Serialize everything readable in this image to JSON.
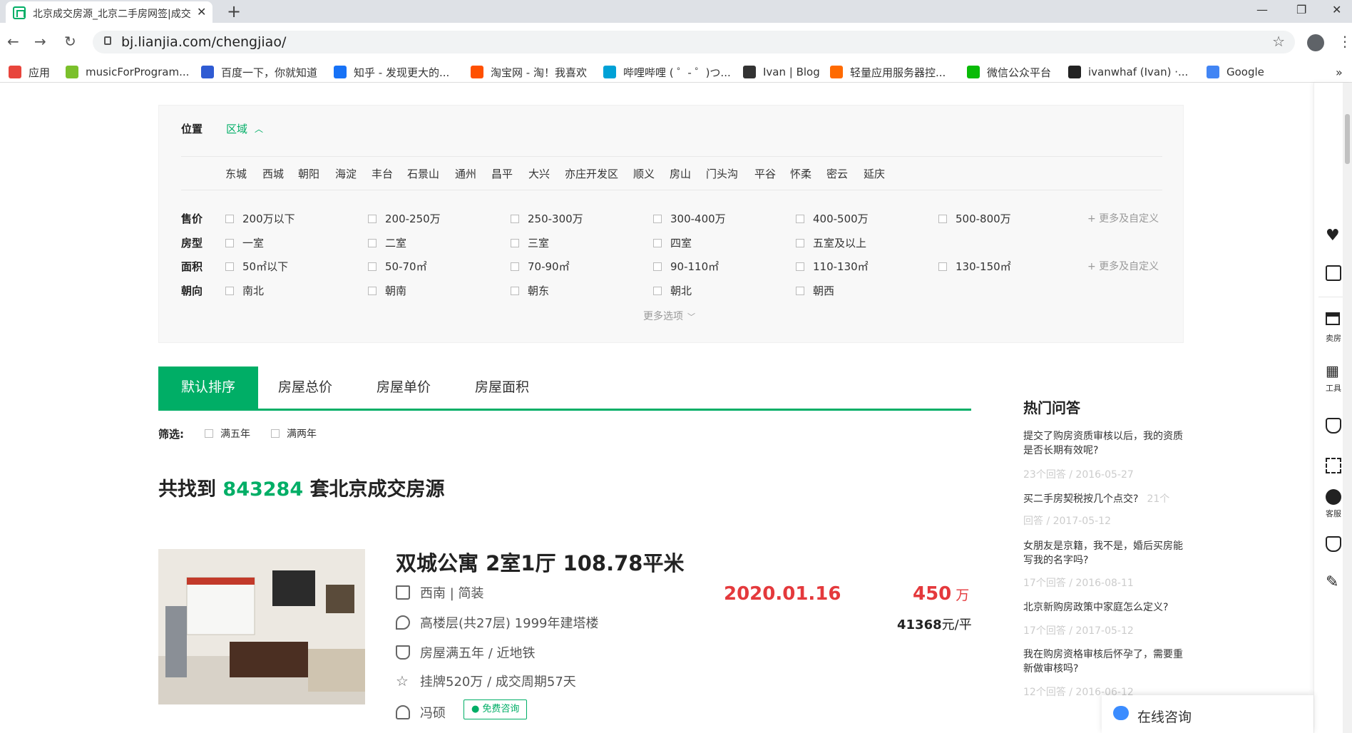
{
  "browser": {
    "tab_title": "北京成交房源_北京二手房网签|成交",
    "url": "bj.lianjia.com/chengjiao/",
    "bookmarks": [
      {
        "label": "应用",
        "color": "#e8453c"
      },
      {
        "label": "musicForProgram...",
        "color": "#7bc02b"
      },
      {
        "label": "百度一下，你就知道",
        "color": "#2f5bd3"
      },
      {
        "label": "知乎 - 发现更大的...",
        "color": "#1772f6"
      },
      {
        "label": "淘宝网 - 淘！我喜欢",
        "color": "#ff5000"
      },
      {
        "label": "哔哩哔哩 ( ゜- ゜)つ...",
        "color": "#00a1d6"
      },
      {
        "label": "Ivan | Blog",
        "color": "#333333"
      },
      {
        "label": "轻量应用服务器控...",
        "color": "#ff6a00"
      },
      {
        "label": "微信公众平台",
        "color": "#09bb07"
      },
      {
        "label": "ivanwhaf (Ivan) ·...",
        "color": "#222222"
      },
      {
        "label": "Google",
        "color": "#4285f4"
      }
    ],
    "more_bookmarks": "»"
  },
  "filter": {
    "location_label": "位置",
    "area_label": "区域",
    "districts": [
      "东城",
      "西城",
      "朝阳",
      "海淀",
      "丰台",
      "石景山",
      "通州",
      "昌平",
      "大兴",
      "亦庄开发区",
      "顺义",
      "房山",
      "门头沟",
      "平谷",
      "怀柔",
      "密云",
      "延庆"
    ],
    "price_label": "售价",
    "price_options": [
      "200万以下",
      "200-250万",
      "250-300万",
      "300-400万",
      "400-500万",
      "500-800万"
    ],
    "layout_label": "房型",
    "layout_options": [
      "一室",
      "二室",
      "三室",
      "四室",
      "五室及以上"
    ],
    "size_label": "面积",
    "size_options": [
      "50㎡以下",
      "50-70㎡",
      "70-90㎡",
      "90-110㎡",
      "110-130㎡",
      "130-150㎡"
    ],
    "direction_label": "朝向",
    "direction_options": [
      "南北",
      "朝南",
      "朝东",
      "朝北",
      "朝西"
    ],
    "more_custom": "+ 更多及自定义",
    "more_options": "更多选项"
  },
  "sort": {
    "tabs": [
      "默认排序",
      "房屋总价",
      "房屋单价",
      "房屋面积"
    ],
    "screen_label": "筛选:",
    "screen_options": [
      "满五年",
      "满两年"
    ]
  },
  "result": {
    "prefix": "共找到",
    "count": "843284",
    "suffix": "套北京成交房源"
  },
  "listing": {
    "title": "双城公寓 2室1厅 108.78平米",
    "orientation": "西南 | 简装",
    "floor": "高楼层(共27层) 1999年建塔楼",
    "tags": "房屋满五年 / 近地铁",
    "listing_info": "挂牌520万 / 成交周期57天",
    "agent": "冯硕",
    "consult_btn": "免费咨询",
    "deal_date": "2020.01.16",
    "total_price": "450",
    "total_unit": "万",
    "unit_price": "41368",
    "unit_price_unit": "元/平"
  },
  "qa": {
    "title": "热门问答",
    "items": [
      {
        "q": "提交了购房资质审核以后，我的资质是否长期有效呢?",
        "meta": "23个回答 / 2016-05-27"
      },
      {
        "q": "买二手房契税按几个点交?",
        "meta_inline": "21个",
        "meta": "回答 / 2017-05-12"
      },
      {
        "q": "女朋友是京籍，我不是，婚后买房能写我的名字吗?",
        "meta": "17个回答 / 2016-08-11"
      },
      {
        "q": "北京新购房政策中家庭怎么定义?",
        "meta": "17个回答 / 2017-05-12"
      },
      {
        "q": "我在购房资格审核后怀孕了，需要重新做审核吗?",
        "meta": "12个回答 / 2016-06-12"
      }
    ]
  },
  "sidebar": {
    "sell_label": "卖房",
    "tools_label": "工具",
    "service_label": "客服"
  },
  "consult": {
    "label": "在线咨询"
  }
}
